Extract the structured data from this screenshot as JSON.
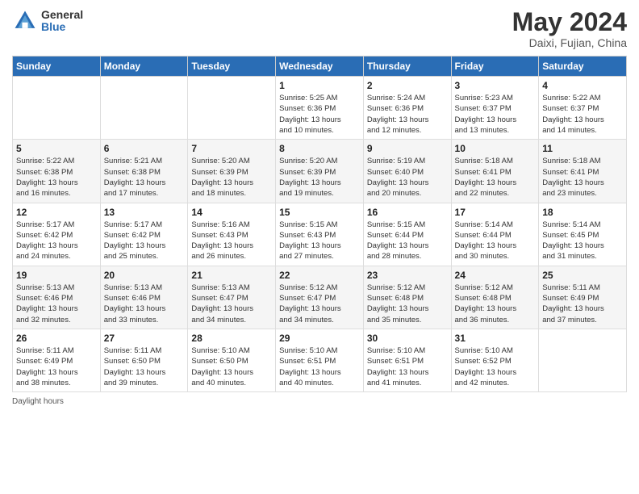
{
  "header": {
    "logo_general": "General",
    "logo_blue": "Blue",
    "title": "May 2024",
    "location": "Daixi, Fujian, China"
  },
  "weekdays": [
    "Sunday",
    "Monday",
    "Tuesday",
    "Wednesday",
    "Thursday",
    "Friday",
    "Saturday"
  ],
  "weeks": [
    [
      {
        "day": "",
        "info": ""
      },
      {
        "day": "",
        "info": ""
      },
      {
        "day": "",
        "info": ""
      },
      {
        "day": "1",
        "info": "Sunrise: 5:25 AM\nSunset: 6:36 PM\nDaylight: 13 hours\nand 10 minutes."
      },
      {
        "day": "2",
        "info": "Sunrise: 5:24 AM\nSunset: 6:36 PM\nDaylight: 13 hours\nand 12 minutes."
      },
      {
        "day": "3",
        "info": "Sunrise: 5:23 AM\nSunset: 6:37 PM\nDaylight: 13 hours\nand 13 minutes."
      },
      {
        "day": "4",
        "info": "Sunrise: 5:22 AM\nSunset: 6:37 PM\nDaylight: 13 hours\nand 14 minutes."
      }
    ],
    [
      {
        "day": "5",
        "info": "Sunrise: 5:22 AM\nSunset: 6:38 PM\nDaylight: 13 hours\nand 16 minutes."
      },
      {
        "day": "6",
        "info": "Sunrise: 5:21 AM\nSunset: 6:38 PM\nDaylight: 13 hours\nand 17 minutes."
      },
      {
        "day": "7",
        "info": "Sunrise: 5:20 AM\nSunset: 6:39 PM\nDaylight: 13 hours\nand 18 minutes."
      },
      {
        "day": "8",
        "info": "Sunrise: 5:20 AM\nSunset: 6:39 PM\nDaylight: 13 hours\nand 19 minutes."
      },
      {
        "day": "9",
        "info": "Sunrise: 5:19 AM\nSunset: 6:40 PM\nDaylight: 13 hours\nand 20 minutes."
      },
      {
        "day": "10",
        "info": "Sunrise: 5:18 AM\nSunset: 6:41 PM\nDaylight: 13 hours\nand 22 minutes."
      },
      {
        "day": "11",
        "info": "Sunrise: 5:18 AM\nSunset: 6:41 PM\nDaylight: 13 hours\nand 23 minutes."
      }
    ],
    [
      {
        "day": "12",
        "info": "Sunrise: 5:17 AM\nSunset: 6:42 PM\nDaylight: 13 hours\nand 24 minutes."
      },
      {
        "day": "13",
        "info": "Sunrise: 5:17 AM\nSunset: 6:42 PM\nDaylight: 13 hours\nand 25 minutes."
      },
      {
        "day": "14",
        "info": "Sunrise: 5:16 AM\nSunset: 6:43 PM\nDaylight: 13 hours\nand 26 minutes."
      },
      {
        "day": "15",
        "info": "Sunrise: 5:15 AM\nSunset: 6:43 PM\nDaylight: 13 hours\nand 27 minutes."
      },
      {
        "day": "16",
        "info": "Sunrise: 5:15 AM\nSunset: 6:44 PM\nDaylight: 13 hours\nand 28 minutes."
      },
      {
        "day": "17",
        "info": "Sunrise: 5:14 AM\nSunset: 6:44 PM\nDaylight: 13 hours\nand 30 minutes."
      },
      {
        "day": "18",
        "info": "Sunrise: 5:14 AM\nSunset: 6:45 PM\nDaylight: 13 hours\nand 31 minutes."
      }
    ],
    [
      {
        "day": "19",
        "info": "Sunrise: 5:13 AM\nSunset: 6:46 PM\nDaylight: 13 hours\nand 32 minutes."
      },
      {
        "day": "20",
        "info": "Sunrise: 5:13 AM\nSunset: 6:46 PM\nDaylight: 13 hours\nand 33 minutes."
      },
      {
        "day": "21",
        "info": "Sunrise: 5:13 AM\nSunset: 6:47 PM\nDaylight: 13 hours\nand 34 minutes."
      },
      {
        "day": "22",
        "info": "Sunrise: 5:12 AM\nSunset: 6:47 PM\nDaylight: 13 hours\nand 34 minutes."
      },
      {
        "day": "23",
        "info": "Sunrise: 5:12 AM\nSunset: 6:48 PM\nDaylight: 13 hours\nand 35 minutes."
      },
      {
        "day": "24",
        "info": "Sunrise: 5:12 AM\nSunset: 6:48 PM\nDaylight: 13 hours\nand 36 minutes."
      },
      {
        "day": "25",
        "info": "Sunrise: 5:11 AM\nSunset: 6:49 PM\nDaylight: 13 hours\nand 37 minutes."
      }
    ],
    [
      {
        "day": "26",
        "info": "Sunrise: 5:11 AM\nSunset: 6:49 PM\nDaylight: 13 hours\nand 38 minutes."
      },
      {
        "day": "27",
        "info": "Sunrise: 5:11 AM\nSunset: 6:50 PM\nDaylight: 13 hours\nand 39 minutes."
      },
      {
        "day": "28",
        "info": "Sunrise: 5:10 AM\nSunset: 6:50 PM\nDaylight: 13 hours\nand 40 minutes."
      },
      {
        "day": "29",
        "info": "Sunrise: 5:10 AM\nSunset: 6:51 PM\nDaylight: 13 hours\nand 40 minutes."
      },
      {
        "day": "30",
        "info": "Sunrise: 5:10 AM\nSunset: 6:51 PM\nDaylight: 13 hours\nand 41 minutes."
      },
      {
        "day": "31",
        "info": "Sunrise: 5:10 AM\nSunset: 6:52 PM\nDaylight: 13 hours\nand 42 minutes."
      },
      {
        "day": "",
        "info": ""
      }
    ]
  ],
  "footer": {
    "daylight_label": "Daylight hours"
  }
}
